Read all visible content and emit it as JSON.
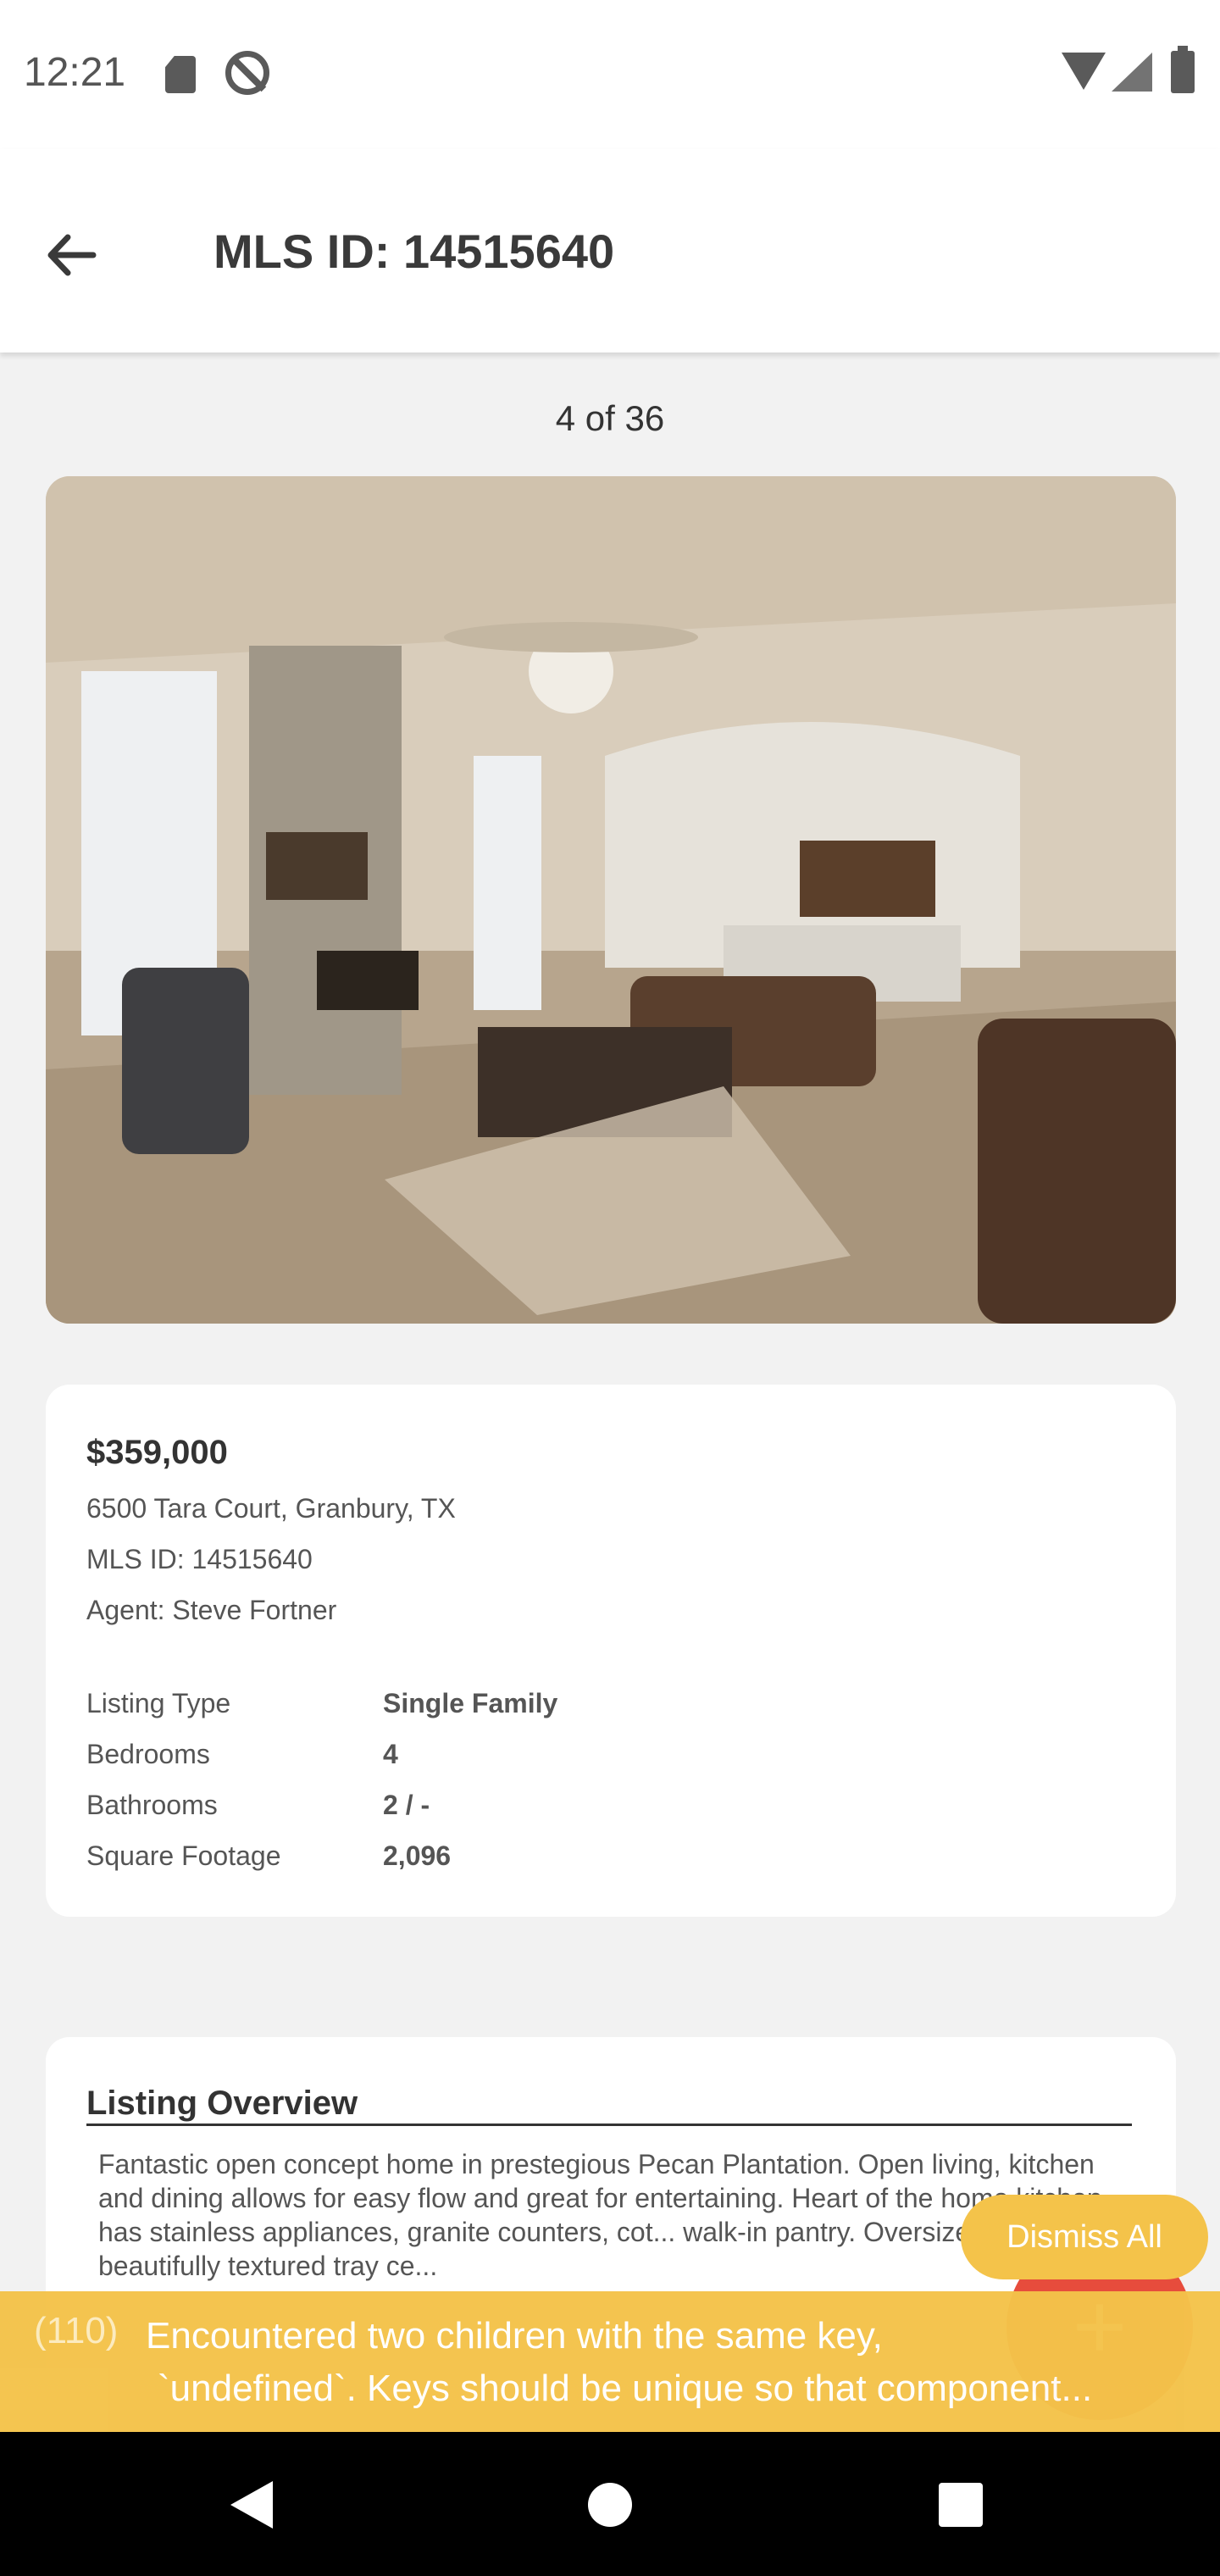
{
  "status_bar": {
    "time": "12:21"
  },
  "header": {
    "title": "MLS ID: 14515640"
  },
  "gallery": {
    "counter": "4 of 36"
  },
  "listing": {
    "price": "$359,000",
    "address": "6500 Tara Court, Granbury, TX",
    "mls": "MLS ID: 14515640",
    "agent": "Agent: Steve Fortner",
    "specs": [
      {
        "label": "Listing Type",
        "value": "Single Family"
      },
      {
        "label": "Bedrooms",
        "value": "4"
      },
      {
        "label": "Bathrooms",
        "value": "2 / -"
      },
      {
        "label": "Square Footage",
        "value": "2,096"
      }
    ]
  },
  "overview": {
    "title": "Listing Overview",
    "text": "Fantastic open concept home in prestegious Pecan Plantation.  Open living, kitchen and dining allows for easy flow and great for entertaining.  Heart of the home kitchen has stainless appliances, granite counters, cot... walk-in pantry.  Oversized master with beautifully textured tray ce..."
  },
  "toast": {
    "dismiss_label": "Dismiss All",
    "count": "(110)",
    "message_line1": "Encountered two children with the same key,",
    "message_line2": "`undefined`. Keys should be unique so that component..."
  },
  "colors": {
    "accent": "#e74c3c",
    "toast": "#f4c34a"
  }
}
